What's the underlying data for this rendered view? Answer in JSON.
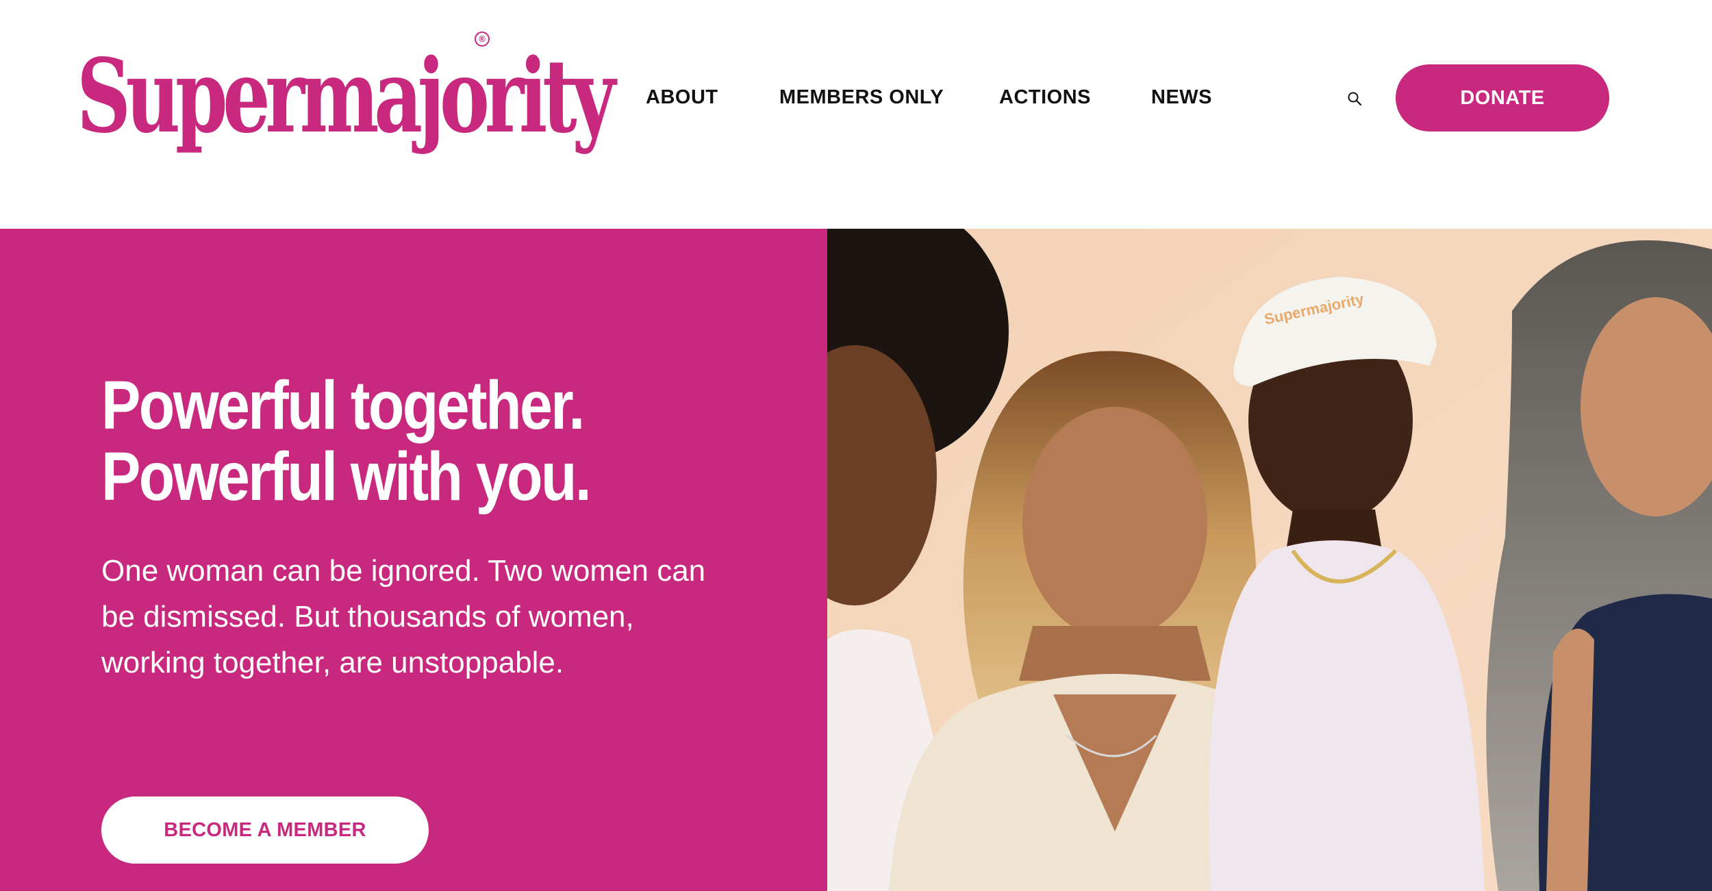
{
  "header": {
    "logo_text": "Supermajority",
    "logo_registered": "®",
    "nav": [
      {
        "label": "ABOUT"
      },
      {
        "label": "MEMBERS ONLY"
      },
      {
        "label": "ACTIONS"
      },
      {
        "label": "NEWS"
      }
    ],
    "search_icon": "search-icon",
    "donate_label": "DONATE"
  },
  "hero": {
    "headline_line1": "Powerful together.",
    "headline_line2": "Powerful with you.",
    "body": "One woman can be ignored. Two women can be dismissed. But thousands of women, working together, are unstoppable.",
    "cta_label": "BECOME A MEMBER",
    "photo_cap_text": "Supermajority"
  },
  "colors": {
    "brand_magenta": "#c8297e",
    "background": "#ffffff",
    "nav_text": "#111111",
    "photo_backdrop": "#f6d7bd"
  }
}
